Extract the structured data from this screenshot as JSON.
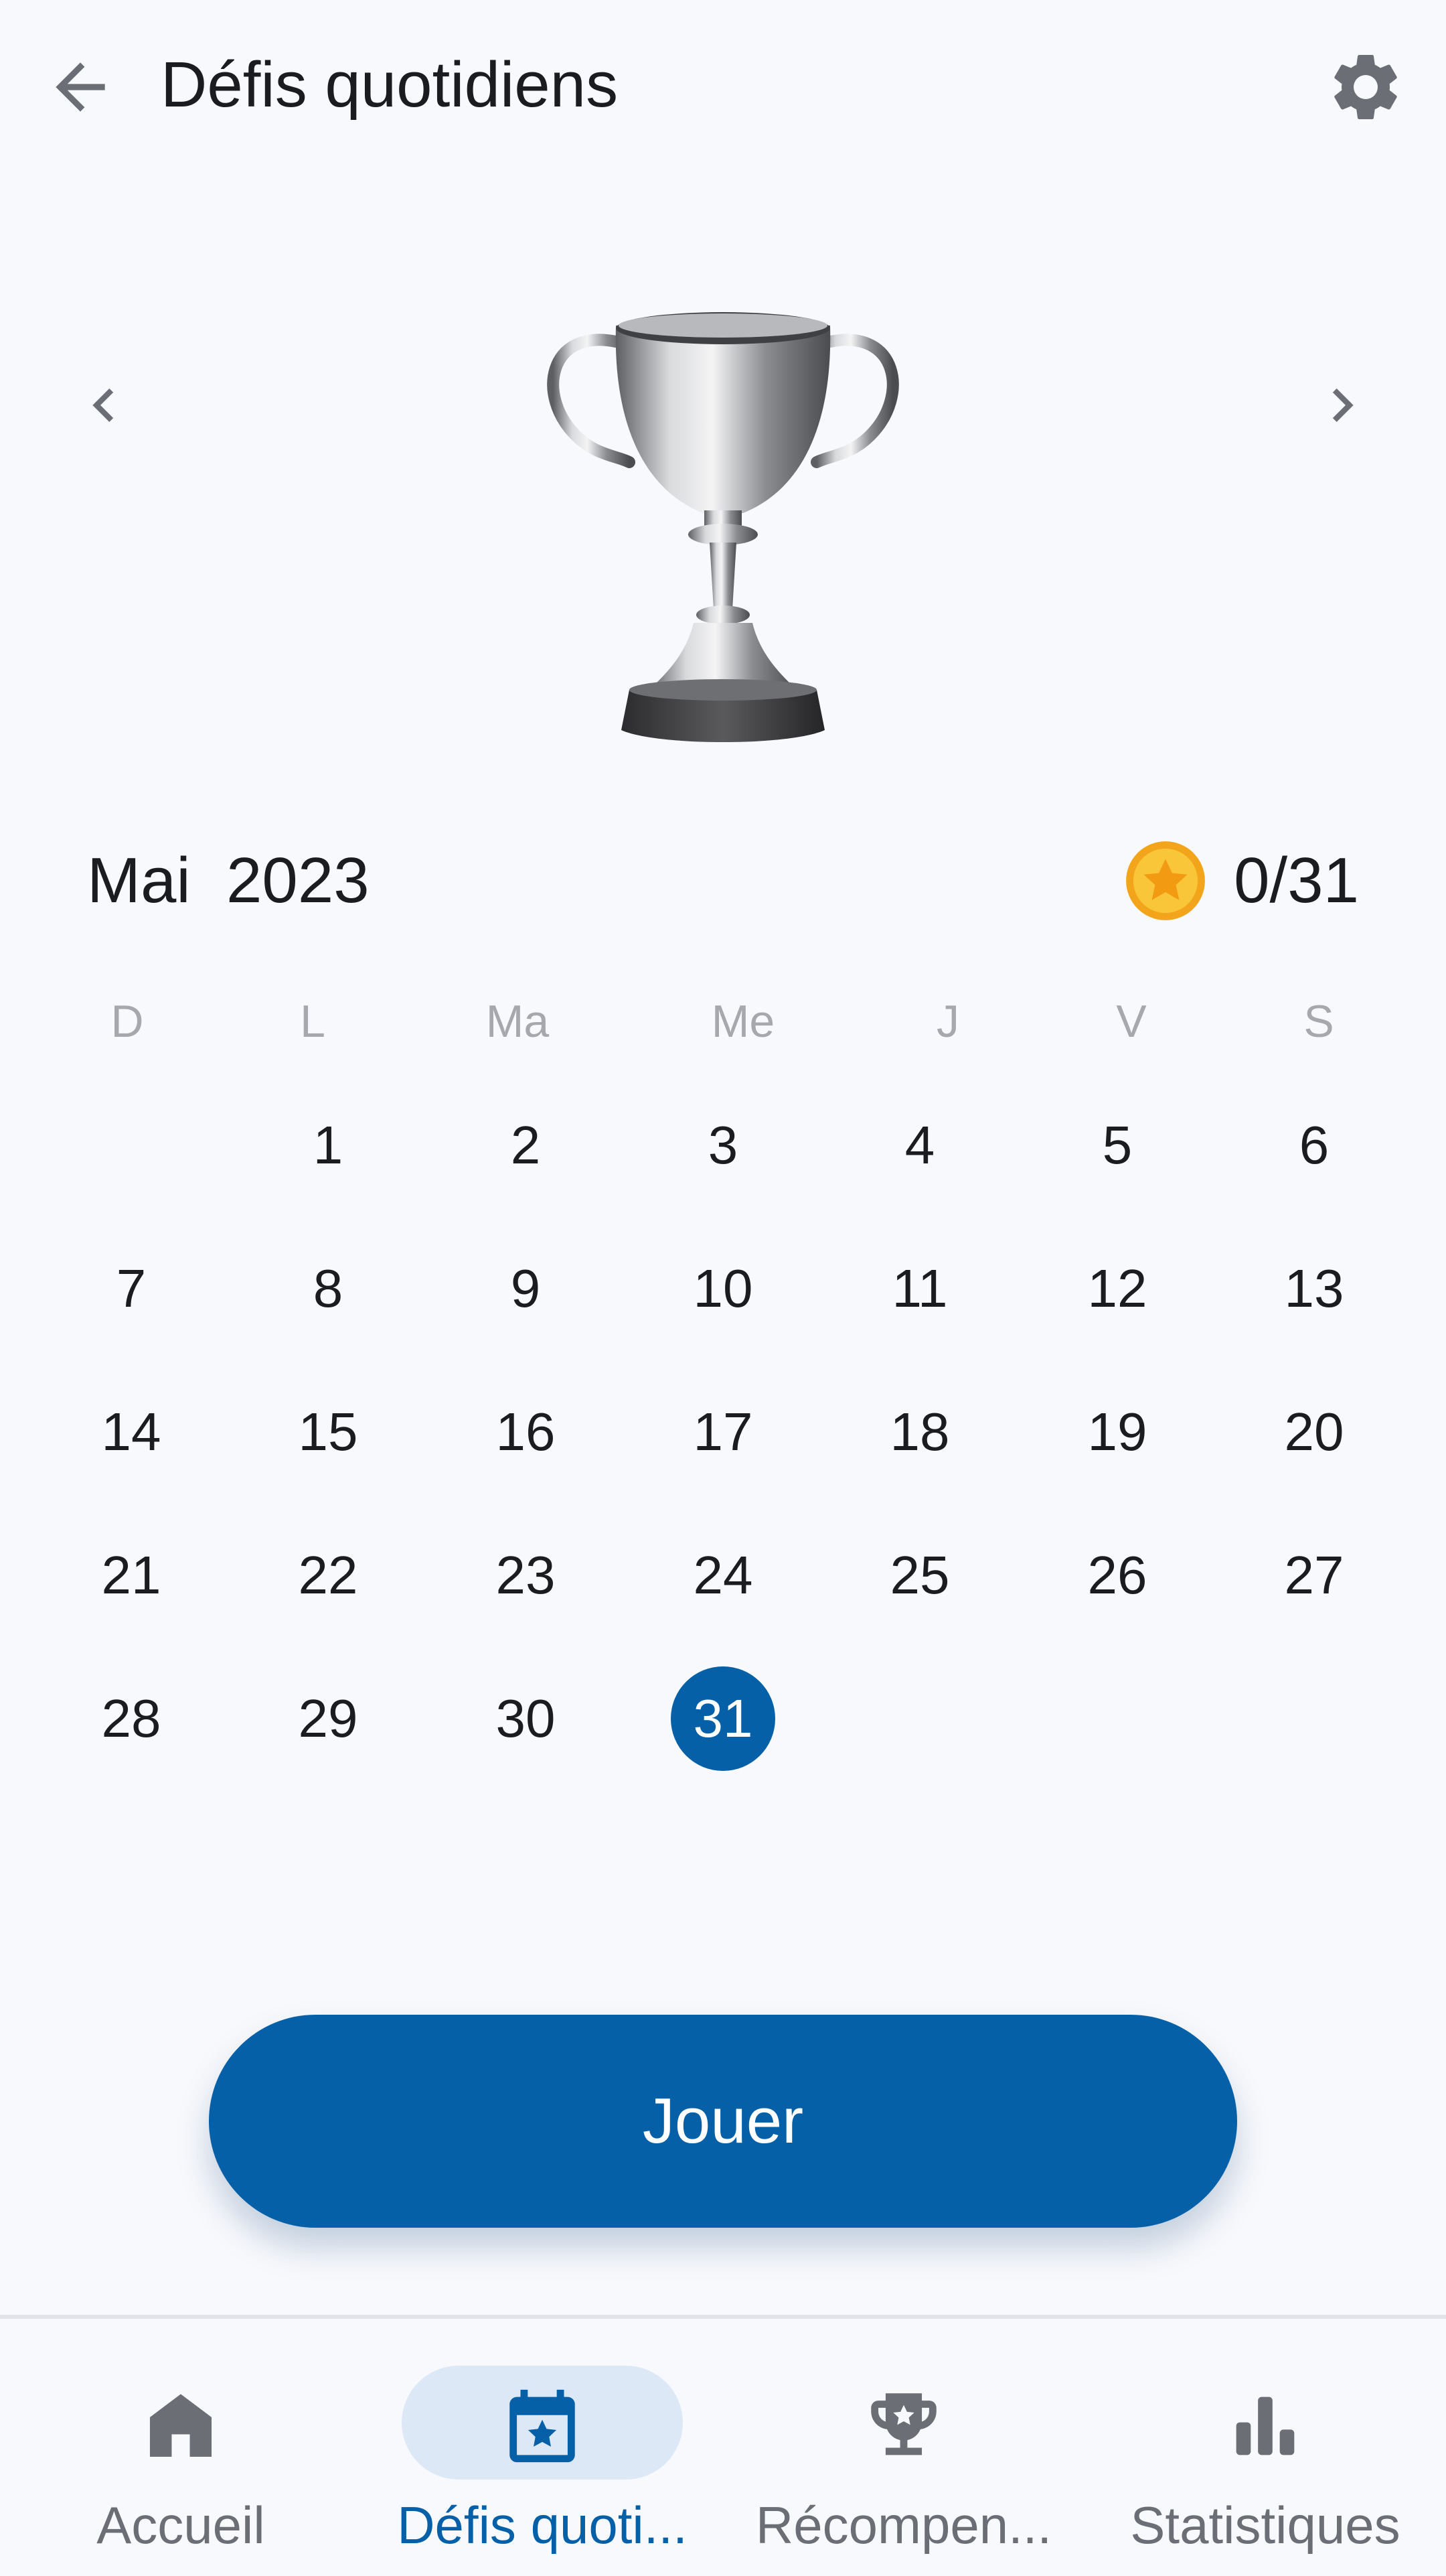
{
  "header": {
    "title": "Défis quotidiens",
    "back_icon": "arrow-left-icon",
    "settings_icon": "gear-icon"
  },
  "hero": {
    "image": "silver-trophy",
    "prev_icon": "chevron-left-icon",
    "next_icon": "chevron-right-icon"
  },
  "month": {
    "label": "Mai  2023",
    "coin_icon": "gold-coin-star-icon",
    "progress": "0/31"
  },
  "calendar": {
    "weekdays": [
      "D",
      "L",
      "Ma",
      "Me",
      "J",
      "V",
      "S"
    ],
    "weeks": [
      [
        "",
        "1",
        "2",
        "3",
        "4",
        "5",
        "6"
      ],
      [
        "7",
        "8",
        "9",
        "10",
        "11",
        "12",
        "13"
      ],
      [
        "14",
        "15",
        "16",
        "17",
        "18",
        "19",
        "20"
      ],
      [
        "21",
        "22",
        "23",
        "24",
        "25",
        "26",
        "27"
      ],
      [
        "28",
        "29",
        "30",
        "31",
        "",
        "",
        ""
      ]
    ],
    "selected_day": "31"
  },
  "play_button": {
    "label": "Jouer"
  },
  "bottom_nav": {
    "items": [
      {
        "label": "Accueil",
        "icon": "home-icon",
        "active": false
      },
      {
        "label": "Défis quoti...",
        "icon": "calendar-star-icon",
        "active": true
      },
      {
        "label": "Récompen...",
        "icon": "trophy-icon",
        "active": false
      },
      {
        "label": "Statistiques",
        "icon": "bar-chart-icon",
        "active": false
      }
    ]
  },
  "colors": {
    "primary": "#0560a7",
    "background": "#f8f9fc",
    "active_pill": "#dde8f6",
    "coin": "#f6b51e"
  }
}
